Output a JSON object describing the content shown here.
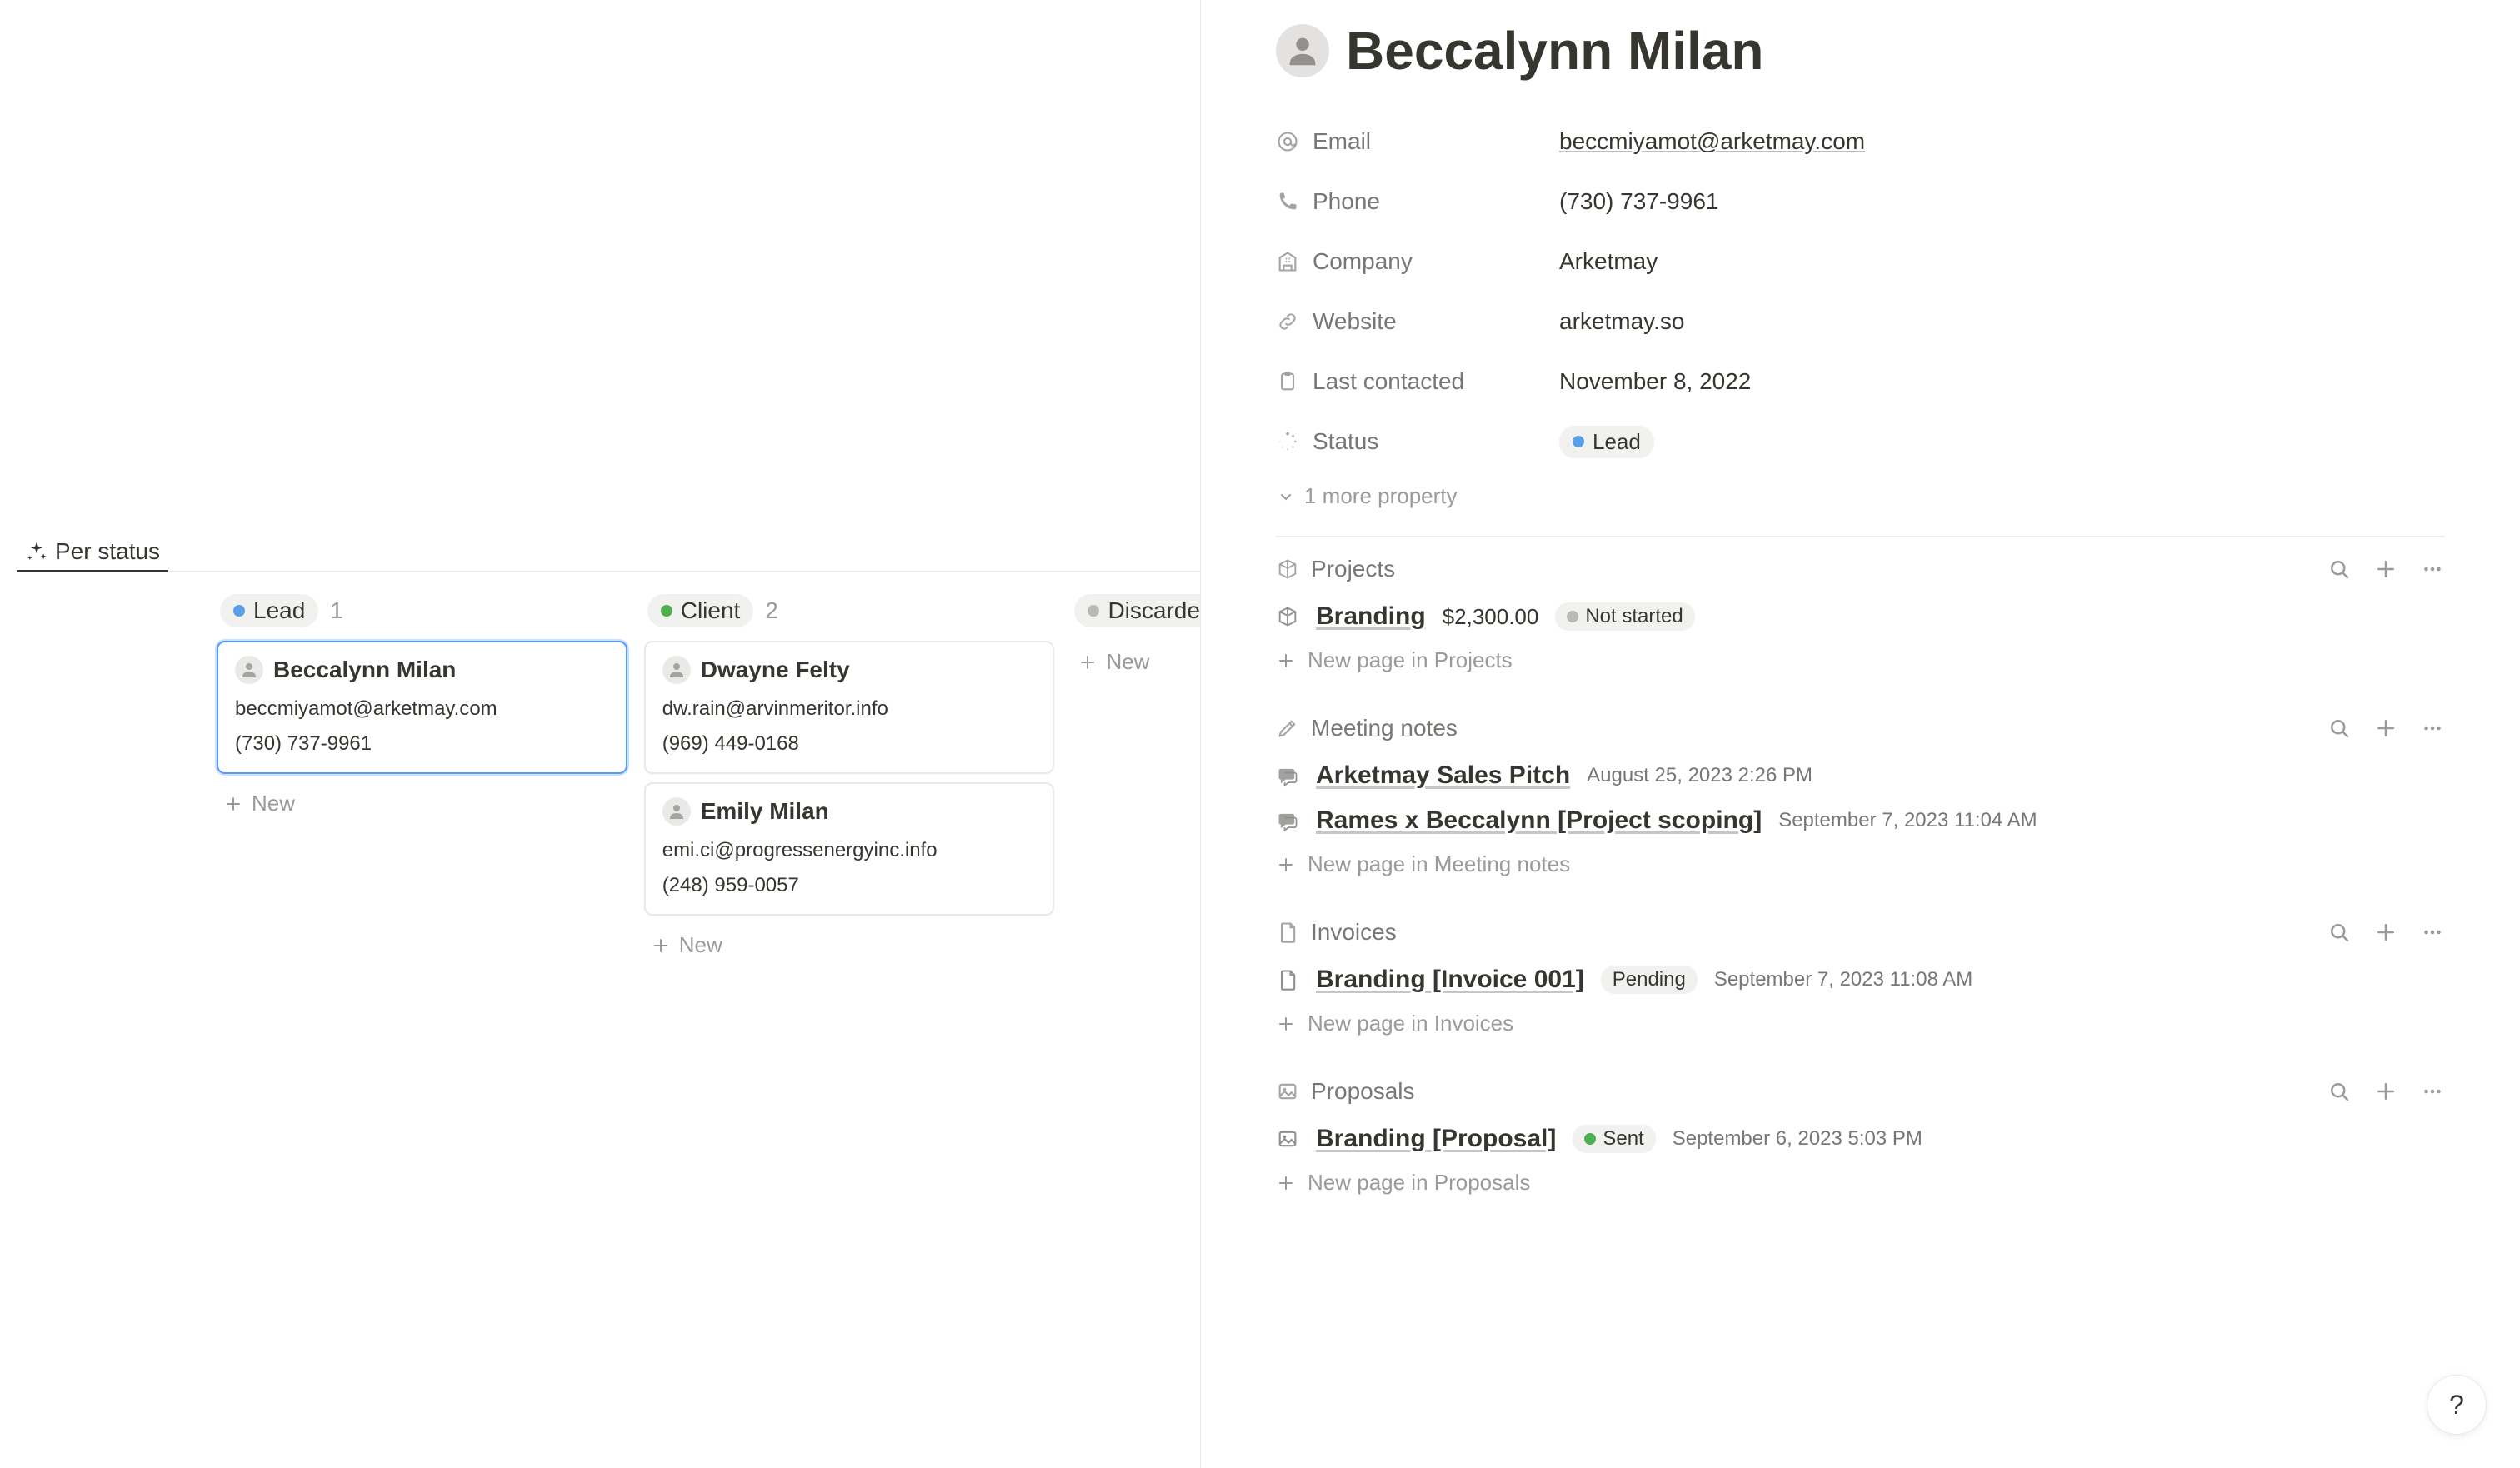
{
  "view": {
    "tab_label": "Per status"
  },
  "board": {
    "columns": [
      {
        "status": "Lead",
        "dot": "blue",
        "count": "1",
        "cards": [
          {
            "name": "Beccalynn Milan",
            "email": "beccmiyamot@arketmay.com",
            "phone": "(730) 737-9961",
            "selected": true
          }
        ],
        "new_label": "New"
      },
      {
        "status": "Client",
        "dot": "green",
        "count": "2",
        "cards": [
          {
            "name": "Dwayne Felty",
            "email": "dw.rain@arvinmeritor.info",
            "phone": "(969) 449-0168",
            "selected": false
          },
          {
            "name": "Emily Milan",
            "email": "emi.ci@progressenergyinc.info",
            "phone": "(248) 959-0057",
            "selected": false
          }
        ],
        "new_label": "New"
      },
      {
        "status": "Discarded",
        "dot": "gray",
        "count": "",
        "cards": [],
        "new_label": "New"
      }
    ]
  },
  "detail": {
    "name": "Beccalynn Milan",
    "props": {
      "email_label": "Email",
      "email_value": "beccmiyamot@arketmay.com",
      "phone_label": "Phone",
      "phone_value": "(730) 737-9961",
      "company_label": "Company",
      "company_value": "Arketmay",
      "website_label": "Website",
      "website_value": "arketmay.so",
      "lastcontacted_label": "Last contacted",
      "lastcontacted_value": "November 8, 2022",
      "status_label": "Status",
      "status_value": "Lead"
    },
    "more_properties": "1 more property",
    "sections": {
      "projects": {
        "title": "Projects",
        "items": [
          {
            "title": "Branding",
            "meta": "$2,300.00",
            "pill": "Not started",
            "pill_dot": "gray"
          }
        ],
        "new_label": "New page in Projects"
      },
      "meeting_notes": {
        "title": "Meeting notes",
        "items": [
          {
            "title": "Arketmay Sales Pitch",
            "date": "August 25, 2023 2:26 PM"
          },
          {
            "title": "Rames x Beccalynn [Project scoping]",
            "date": "September 7, 2023 11:04 AM"
          }
        ],
        "new_label": "New page in Meeting notes"
      },
      "invoices": {
        "title": "Invoices",
        "items": [
          {
            "title": "Branding [Invoice 001]",
            "pill": "Pending",
            "date": "September 7, 2023 11:08 AM"
          }
        ],
        "new_label": "New page in Invoices"
      },
      "proposals": {
        "title": "Proposals",
        "items": [
          {
            "title": "Branding [Proposal]",
            "pill": "Sent",
            "pill_dot": "green",
            "date": "September 6, 2023 5:03 PM"
          }
        ],
        "new_label": "New page in Proposals"
      }
    }
  },
  "help": "?"
}
